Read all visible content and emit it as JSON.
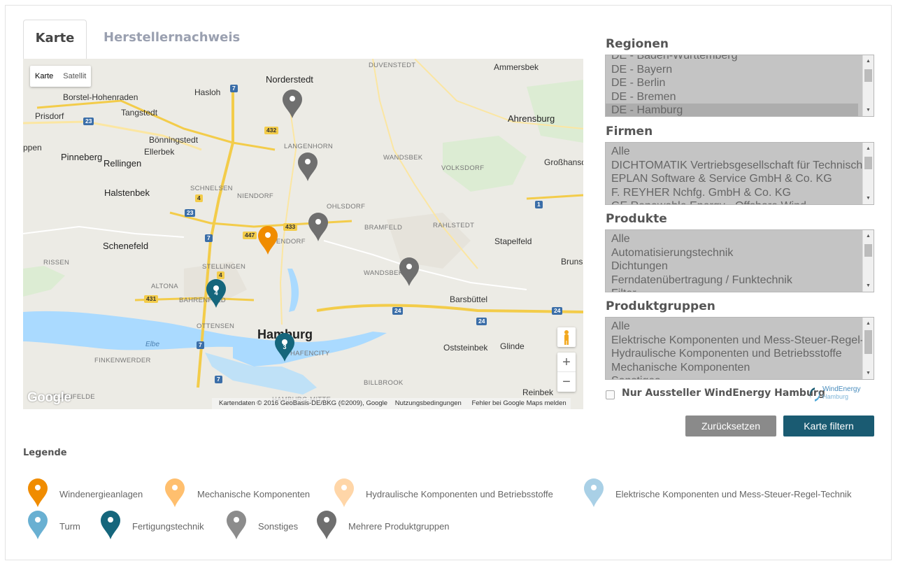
{
  "tabs": [
    {
      "label": "Karte",
      "active": true
    },
    {
      "label": "Herstellernachweis",
      "active": false
    }
  ],
  "map": {
    "maptype": {
      "selected": "Karte",
      "other": "Satellit"
    },
    "zoom_in": "+",
    "zoom_out": "−",
    "logo": "Google",
    "attribution": "Kartendaten © 2016 GeoBasis-DE/BKG (©2009), Google",
    "terms": "Nutzungsbedingungen",
    "report": "Fehler bei Google Maps melden",
    "places": [
      "Norderstedt",
      "Ammersbek",
      "Hasloh",
      "Borstel-Hohenraden",
      "Tangstedt",
      "Prisdorf",
      "Bönningstedt",
      "Ahrensburg",
      "Ellerbek",
      "LANGENHORN",
      "WANDSBEK",
      "VOLKSDORF",
      "Großhansd",
      "ppen",
      "Pinneberg",
      "Rellingen",
      "Halstenbek",
      "SCHNELSEN",
      "NIENDORF",
      "OHLSDORF",
      "BRAMFELD",
      "RAHLSTEDT",
      "Stapelfeld",
      "Schenefeld",
      "EPPENDORF",
      "RISSEN",
      "STELLINGEN",
      "WANDSBEK",
      "Brunsl",
      "ALTONA",
      "BAHRENFELD",
      "Barsbüttel",
      "OTTENSEN",
      "Hamburg",
      "Elbe",
      "HAFENCITY",
      "Oststeinbek",
      "Glinde",
      "FINKENWERDER",
      "BILLBROOK",
      "Reinbek",
      "NEUENFELDE",
      "DUVENSTEDT",
      "HAMBURG-MITTE"
    ],
    "roads": [
      "7",
      "23",
      "432",
      "4",
      "447",
      "433",
      "1",
      "23",
      "7",
      "4",
      "431",
      "24",
      "24",
      "24",
      "7",
      "7"
    ],
    "pins": [
      {
        "color": "#6f6f6f",
        "label": ""
      },
      {
        "color": "#6f6f6f",
        "label": ""
      },
      {
        "color": "#f08c00",
        "label": ""
      },
      {
        "color": "#6f6f6f",
        "label": ""
      },
      {
        "color": "#6f6f6f",
        "label": ""
      },
      {
        "color": "#15667c",
        "label": "4"
      },
      {
        "color": "#15667c",
        "label": "3"
      }
    ]
  },
  "filters": {
    "regionen": {
      "title": "Regionen",
      "options": [
        "DE - Baden-Württemberg",
        "DE - Bayern",
        "DE - Berlin",
        "DE - Bremen",
        "DE - Hamburg"
      ],
      "selected": "DE - Hamburg"
    },
    "firmen": {
      "title": "Firmen",
      "options": [
        "Alle",
        "DICHTOMATIK Vertriebsgesellschaft für Technisch",
        "EPLAN Software & Service GmbH & Co. KG",
        "F. REYHER Nchfg. GmbH & Co. KG",
        "GE Renewable Energy - Offshore Wind"
      ]
    },
    "produkte": {
      "title": "Produkte",
      "options": [
        "Alle",
        "Automatisierungstechnik",
        "Dichtungen",
        "Ferndatenübertragung / Funktechnik",
        "Filter"
      ]
    },
    "produktgruppen": {
      "title": "Produktgruppen",
      "options": [
        "Alle",
        "Elektrische Komponenten und Mess-Steuer-Regel-",
        "Hydraulische Komponenten und Betriebsstoffe",
        "Mechanische Komponenten",
        "Sonstiges"
      ]
    },
    "checkbox_label": "Nur Aussteller WindEnergy Hamburg",
    "logo_line1": "WindEnergy",
    "logo_line2": "Hamburg",
    "reset_label": "Zurücksetzen",
    "filter_label": "Karte filtern"
  },
  "legend": {
    "title": "Legende",
    "items": [
      {
        "label": "Windenergieanlagen",
        "color": "#f08c00"
      },
      {
        "label": "Mechanische Komponenten",
        "color": "#ffbf6e"
      },
      {
        "label": "Hydraulische Komponenten und Betriebsstoffe",
        "color": "#ffd6a8"
      },
      {
        "label": "Elektrische Komponenten und Mess-Steuer-Regel-Technik",
        "color": "#a9d0e6"
      },
      {
        "label": "Turm",
        "color": "#69b0d2"
      },
      {
        "label": "Fertigungstechnik",
        "color": "#15667c"
      },
      {
        "label": "Sonstiges",
        "color": "#8c8c8c"
      },
      {
        "label": "Mehrere Produktgruppen",
        "color": "#6f6f6f"
      }
    ]
  }
}
